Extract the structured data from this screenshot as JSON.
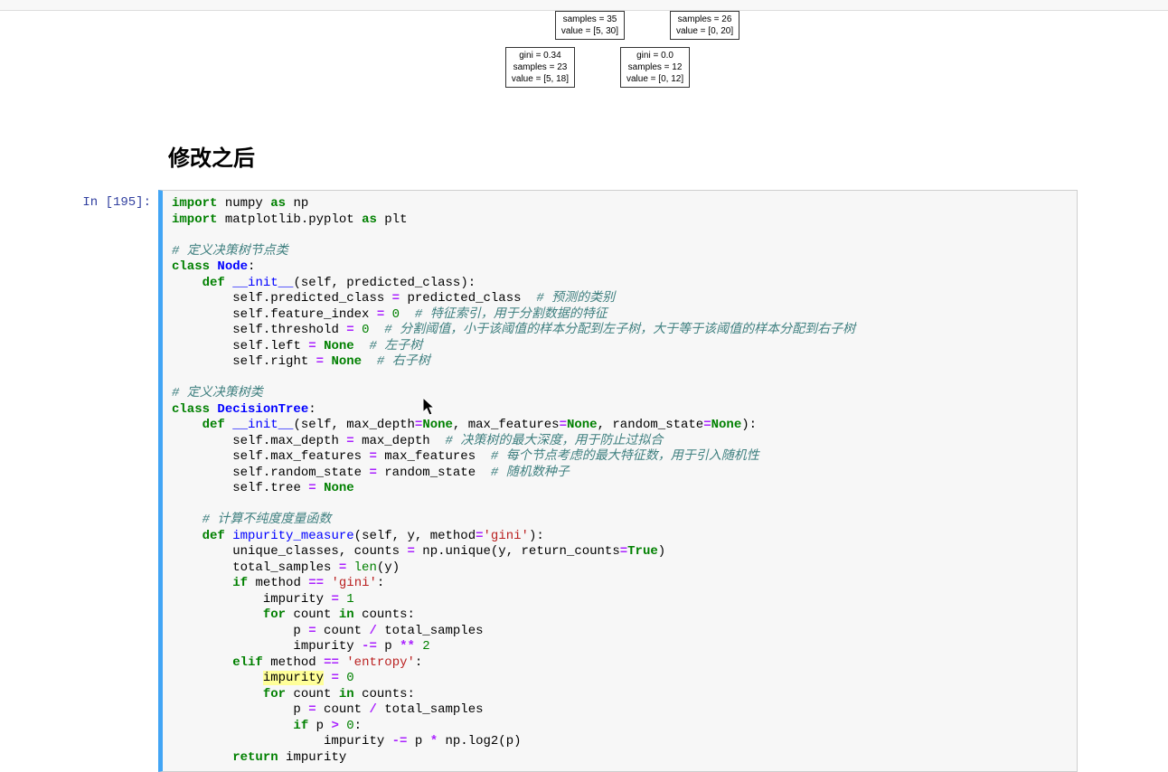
{
  "heading": "修改之后",
  "prompt": "In [195]:",
  "tree": {
    "node0": {
      "l1": "samples = 26",
      "l2": "value = [0, 20]"
    },
    "node1": {
      "l1": "samples = 35",
      "l2": "value = [5, 30]"
    },
    "node2": {
      "l1": "gini = 0.34",
      "l2": "samples = 23",
      "l3": "value = [5, 18]"
    },
    "node3": {
      "l1": "gini = 0.0",
      "l2": "samples = 12",
      "l3": "value = [0, 12]"
    }
  },
  "code": {
    "import_kw": "import",
    "as_kw": "as",
    "numpy": " numpy ",
    "np": " np",
    "matplotlib": " matplotlib.pyplot ",
    "plt": " plt",
    "c_node": "# 定义决策树节点类",
    "class_kw": "class",
    "node_cls": "Node",
    "def_kw": "def",
    "init_fn": "__init__",
    "self": "self",
    "pred_class": "predicted_class",
    "eq": "=",
    "c_pred": "# 预测的类别",
    "feature_index": "feature_index",
    "zero": "0",
    "c_feature": "# 特征索引，用于分割数据的特征",
    "threshold": "threshold",
    "c_threshold": "# 分割阈值，小于该阈值的样本分配到左子树，大于等于该阈值的样本分配到右子树",
    "left": "left",
    "none": "None",
    "c_left": "# 左子树",
    "right": "right",
    "c_right": "# 右子树",
    "c_tree": "# 定义决策树类",
    "tree_cls": "DecisionTree",
    "max_depth": "max_depth",
    "max_features": "max_features",
    "random_state": "random_state",
    "c_maxdepth": "# 决策树的最大深度，用于防止过拟合",
    "c_maxfeat": "# 每个节点考虑的最大特征数，用于引入随机性",
    "c_random": "# 随机数种子",
    "tree": "tree",
    "c_impurity": "# 计算不纯度度量函数",
    "impurity_fn": "impurity_measure",
    "y": "y",
    "method": "method",
    "gini_str": "'gini'",
    "unique_classes": "unique_classes",
    "counts": "counts",
    "np_unique": " np.unique(y, return_counts",
    "true": "True",
    "total_samples": "total_samples",
    "len": "len",
    "if_kw": "if",
    "eqeq": "==",
    "impurity": "impurity",
    "one": "1",
    "for_kw": "for",
    "count": "count",
    "in_kw": "in",
    "p": "p",
    "slash": "/",
    "minuseq": "-=",
    "starstar": "**",
    "two": "2",
    "elif_kw": "elif",
    "entropy_str": "'entropy'",
    "gt": ">",
    "star": "*",
    "log2": " np.log2(p)",
    "return_kw": "return"
  }
}
